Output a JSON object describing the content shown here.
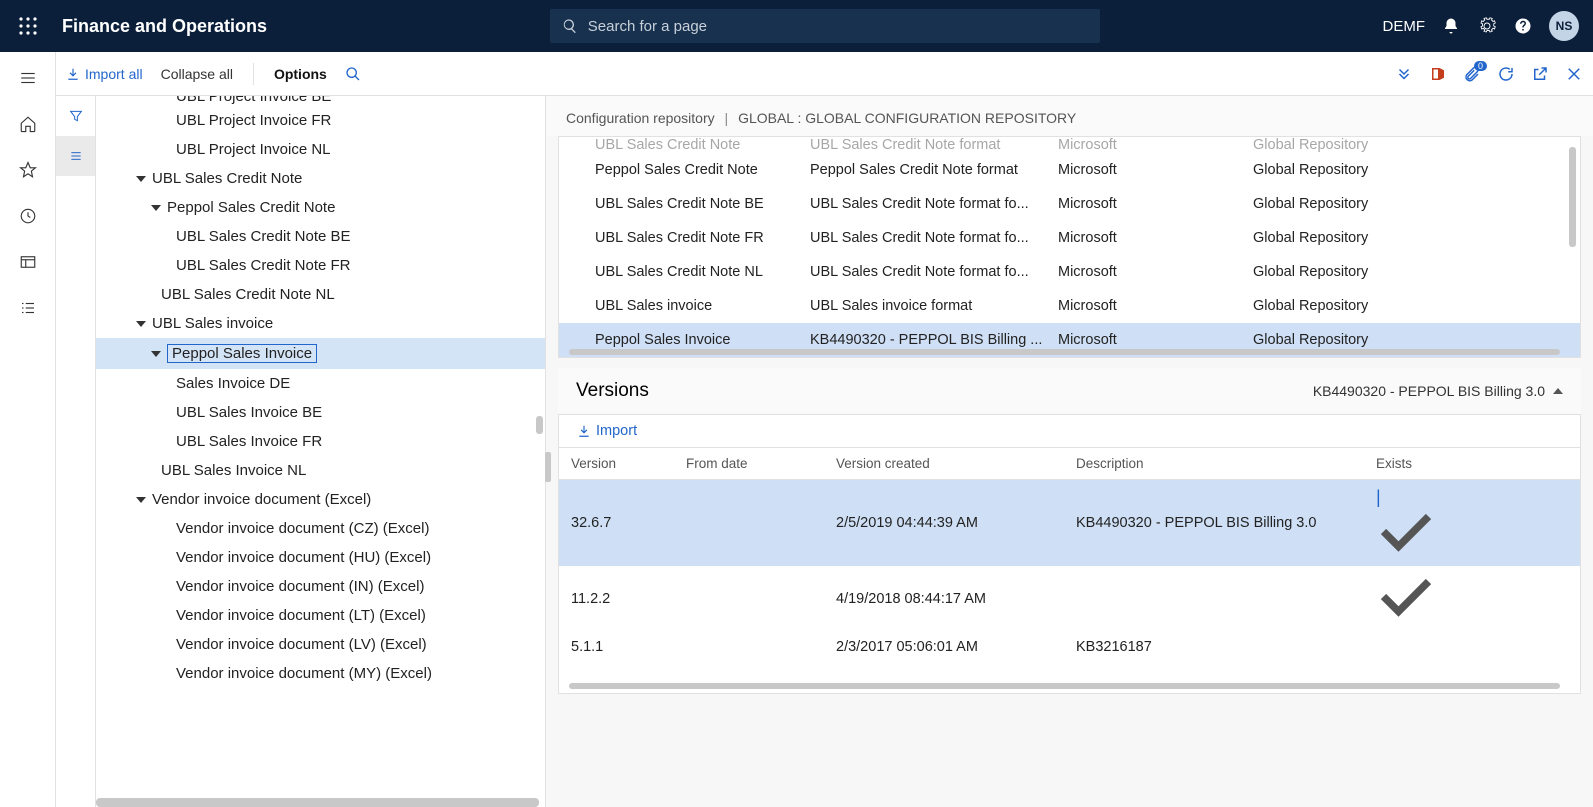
{
  "header": {
    "appTitle": "Finance and Operations",
    "searchPlaceholder": "Search for a page",
    "company": "DEMF",
    "avatar": "NS"
  },
  "commandBar": {
    "importAll": "Import all",
    "collapseAll": "Collapse all",
    "options": "Options"
  },
  "tree": [
    {
      "indent": 80,
      "label": "UBL Project Invoice BE",
      "cut": true
    },
    {
      "indent": 80,
      "label": "UBL Project Invoice FR"
    },
    {
      "indent": 80,
      "label": "UBL Project Invoice NL"
    },
    {
      "indent": 40,
      "label": "UBL Sales Credit Note",
      "caret": true
    },
    {
      "indent": 55,
      "label": "Peppol Sales Credit Note",
      "caret": true
    },
    {
      "indent": 80,
      "label": "UBL Sales Credit Note BE"
    },
    {
      "indent": 80,
      "label": "UBL Sales Credit Note FR"
    },
    {
      "indent": 65,
      "label": "UBL Sales Credit Note NL"
    },
    {
      "indent": 40,
      "label": "UBL Sales invoice",
      "caret": true
    },
    {
      "indent": 55,
      "label": "Peppol Sales Invoice",
      "caret": true,
      "selected": true
    },
    {
      "indent": 80,
      "label": "Sales Invoice DE"
    },
    {
      "indent": 80,
      "label": "UBL Sales Invoice BE"
    },
    {
      "indent": 80,
      "label": "UBL Sales Invoice FR"
    },
    {
      "indent": 65,
      "label": "UBL Sales Invoice NL"
    },
    {
      "indent": 40,
      "label": "Vendor invoice document (Excel)",
      "caret": true
    },
    {
      "indent": 80,
      "label": "Vendor invoice document (CZ) (Excel)"
    },
    {
      "indent": 80,
      "label": "Vendor invoice document (HU) (Excel)"
    },
    {
      "indent": 80,
      "label": "Vendor invoice document (IN) (Excel)"
    },
    {
      "indent": 80,
      "label": "Vendor invoice document (LT) (Excel)"
    },
    {
      "indent": 80,
      "label": "Vendor invoice document (LV) (Excel)"
    },
    {
      "indent": 80,
      "label": "Vendor invoice document (MY) (Excel)"
    }
  ],
  "breadcrumb": {
    "a": "Configuration repository",
    "b": "GLOBAL : GLOBAL CONFIGURATION REPOSITORY"
  },
  "gridRows": [
    {
      "c1": "UBL Sales Credit Note",
      "c2": "UBL Sales Credit Note format",
      "c3": "Microsoft",
      "c4": "Global Repository",
      "cut": true
    },
    {
      "c1": "Peppol Sales Credit Note",
      "c2": "Peppol Sales Credit Note format",
      "c3": "Microsoft",
      "c4": "Global Repository"
    },
    {
      "c1": "UBL Sales Credit Note BE",
      "c2": "UBL Sales Credit Note format fo...",
      "c3": "Microsoft",
      "c4": "Global Repository"
    },
    {
      "c1": "UBL Sales Credit Note FR",
      "c2": "UBL Sales Credit Note format fo...",
      "c3": "Microsoft",
      "c4": "Global Repository"
    },
    {
      "c1": "UBL Sales Credit Note NL",
      "c2": "UBL Sales Credit Note format fo...",
      "c3": "Microsoft",
      "c4": "Global Repository"
    },
    {
      "c1": "UBL Sales invoice",
      "c2": "UBL Sales invoice format",
      "c3": "Microsoft",
      "c4": "Global Repository"
    },
    {
      "c1": "Peppol Sales Invoice",
      "c2": "KB4490320 - PEPPOL BIS Billing ...",
      "c3": "Microsoft",
      "c4": "Global Repository",
      "selected": true
    }
  ],
  "versions": {
    "title": "Versions",
    "subtitle": "KB4490320 - PEPPOL BIS Billing 3.0",
    "importLabel": "Import",
    "headers": {
      "c1": "Version",
      "c2": "From date",
      "c3": "Version created",
      "c4": "Description",
      "c5": "Exists"
    },
    "rows": [
      {
        "c1": "32.6.7",
        "c2": "",
        "c3": "2/5/2019 04:44:39 AM",
        "c4": "KB4490320 - PEPPOL BIS Billing 3.0",
        "exists": true,
        "selected": true
      },
      {
        "c1": "11.2.2",
        "c2": "",
        "c3": "4/19/2018 08:44:17 AM",
        "c4": "",
        "exists": true
      },
      {
        "c1": "5.1.1",
        "c2": "",
        "c3": "2/3/2017 05:06:01 AM",
        "c4": "KB3216187",
        "exists": false
      }
    ]
  }
}
